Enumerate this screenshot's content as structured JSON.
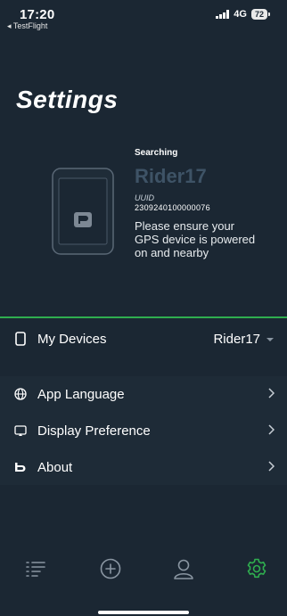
{
  "status_bar": {
    "time": "17:20",
    "back_label": "◂ TestFlight",
    "network": "4G",
    "battery": "72"
  },
  "page": {
    "title": "Settings"
  },
  "device_card": {
    "status": "Searching",
    "device_name": "Rider17",
    "uuid_label": "UUID",
    "uuid_value": "2309240100000076",
    "hint": "Please ensure your GPS device is powered on and nearby"
  },
  "my_devices": {
    "label": "My Devices",
    "value": "Rider17"
  },
  "menu": {
    "language_label": "App Language",
    "display_label": "Display Preference",
    "about_label": "About"
  },
  "icons": {
    "phone": "phone-icon",
    "globe": "globe-icon",
    "display": "display-icon",
    "logo": "brand-logo-icon",
    "list": "list-icon",
    "add": "add-circle-icon",
    "profile": "profile-icon",
    "settings": "gear-icon"
  },
  "colors": {
    "background": "#1b2733",
    "accent_green": "#2fae4f",
    "device_name_muted": "#3e5366"
  }
}
